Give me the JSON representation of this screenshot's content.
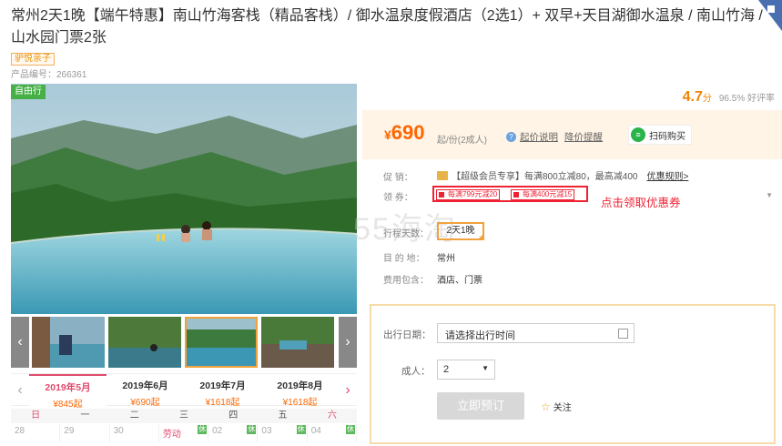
{
  "title": "常州2天1晚【端午特惠】南山竹海客栈（精品客栈）/ 御水温泉度假酒店（2选1）+ 双早+天目湖御水温泉 / 南山竹海 / 山水园门票2张",
  "tag": "驴悦亲子",
  "product_no": "产品编号：266361",
  "badge": "自由行",
  "rating": {
    "score": "4.7",
    "unit": "分",
    "percent": "96.5%",
    "label": "好评率"
  },
  "price": {
    "symbol": "¥",
    "amount": "690",
    "sub": "起/份(2成人)"
  },
  "price_links": {
    "explain": "起价说明",
    "alert": "降价提醒"
  },
  "scan": "扫码购买",
  "promo": {
    "label": "促    销：",
    "text": "【超级会员专享】每满800立减80，最高减400",
    "rule": "优惠规则>"
  },
  "coupon": {
    "label": "领    券：",
    "items": [
      "每满799元减20",
      "每满400元减15"
    ],
    "hint": "点击领取优惠券"
  },
  "watermark": "55海淘",
  "days": {
    "label": "行程天数：",
    "value": "2天1晚"
  },
  "destination": {
    "label": "目 的 地：",
    "value": "常州"
  },
  "includes": {
    "label": "费用包含：",
    "value": "酒店、门票"
  },
  "order": {
    "date_label": "出行日期：",
    "date_value": "请选择出行时间",
    "adult_label": "成人：",
    "adult_value": "2",
    "book": "立即预订",
    "fav": "关注"
  },
  "calendar": {
    "months": [
      {
        "name": "2019年5月",
        "price": "¥845起"
      },
      {
        "name": "2019年6月",
        "price": "¥690起"
      },
      {
        "name": "2019年7月",
        "price": "¥1618起"
      },
      {
        "name": "2019年8月",
        "price": "¥1618起"
      }
    ],
    "weekdays": [
      "日",
      "一",
      "二",
      "三",
      "四",
      "五",
      "六"
    ],
    "days": [
      {
        "d": "28",
        "mark": ""
      },
      {
        "d": "29",
        "mark": ""
      },
      {
        "d": "30",
        "mark": ""
      },
      {
        "d": "劳动",
        "mark": "休"
      },
      {
        "d": "02",
        "mark": "休"
      },
      {
        "d": "03",
        "mark": "休"
      },
      {
        "d": "04",
        "mark": "休"
      }
    ]
  },
  "icons": {
    "thumb_prev": "‹",
    "thumb_next": "›",
    "cal_prev": "‹",
    "cal_next": "›",
    "question": "?",
    "scan_icon": "≡"
  }
}
